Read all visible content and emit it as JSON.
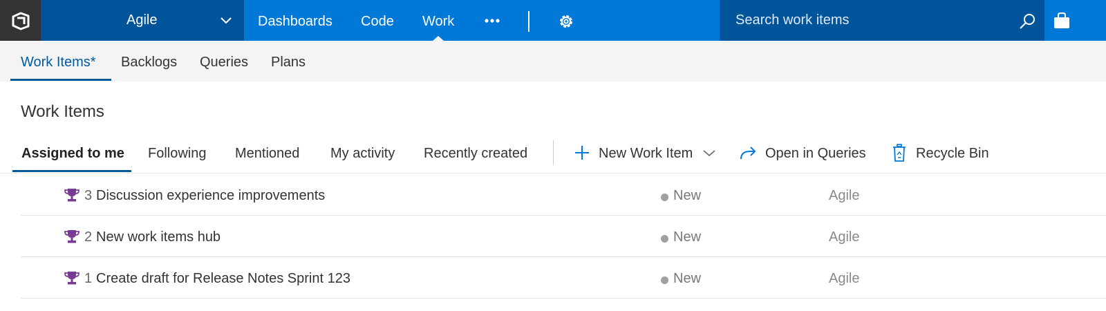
{
  "topbar": {
    "project": "Agile",
    "nav_items": [
      "Dashboards",
      "Code",
      "Work"
    ],
    "active_nav": "Work",
    "search_placeholder": "Search work items",
    "colors": {
      "bar": "#0078d7",
      "dark": "#005499",
      "logo_bg": "#333333"
    },
    "icons": [
      "team-services-logo-icon",
      "chevron-down-icon",
      "ellipsis-icon",
      "gear-icon",
      "search-icon",
      "marketplace-bag-icon"
    ]
  },
  "hub": {
    "tabs": [
      "Work Items*",
      "Backlogs",
      "Queries",
      "Plans"
    ],
    "active_tab": "Work Items*"
  },
  "page": {
    "title": "Work Items"
  },
  "pivots": {
    "items": [
      "Assigned to me",
      "Following",
      "Mentioned",
      "My activity",
      "Recently created"
    ],
    "active": "Assigned to me"
  },
  "toolbar": {
    "new_work_item": "New Work Item",
    "open_in_queries": "Open in Queries",
    "recycle_bin": "Recycle Bin",
    "accent_color": "#0078d7"
  },
  "work_items": [
    {
      "id": "3",
      "title": "Discussion experience improvements",
      "state": "New",
      "area": "Agile",
      "type_icon": "trophy-icon"
    },
    {
      "id": "2",
      "title": "New work items hub",
      "state": "New",
      "area": "Agile",
      "type_icon": "trophy-icon"
    },
    {
      "id": "1",
      "title": "Create draft for Release Notes Sprint 123",
      "state": "New",
      "area": "Agile",
      "type_icon": "trophy-icon"
    }
  ],
  "colors": {
    "active_underline": "#005a9e",
    "epic_purple": "#773b93",
    "state_new_dot": "#a0a0a0"
  }
}
